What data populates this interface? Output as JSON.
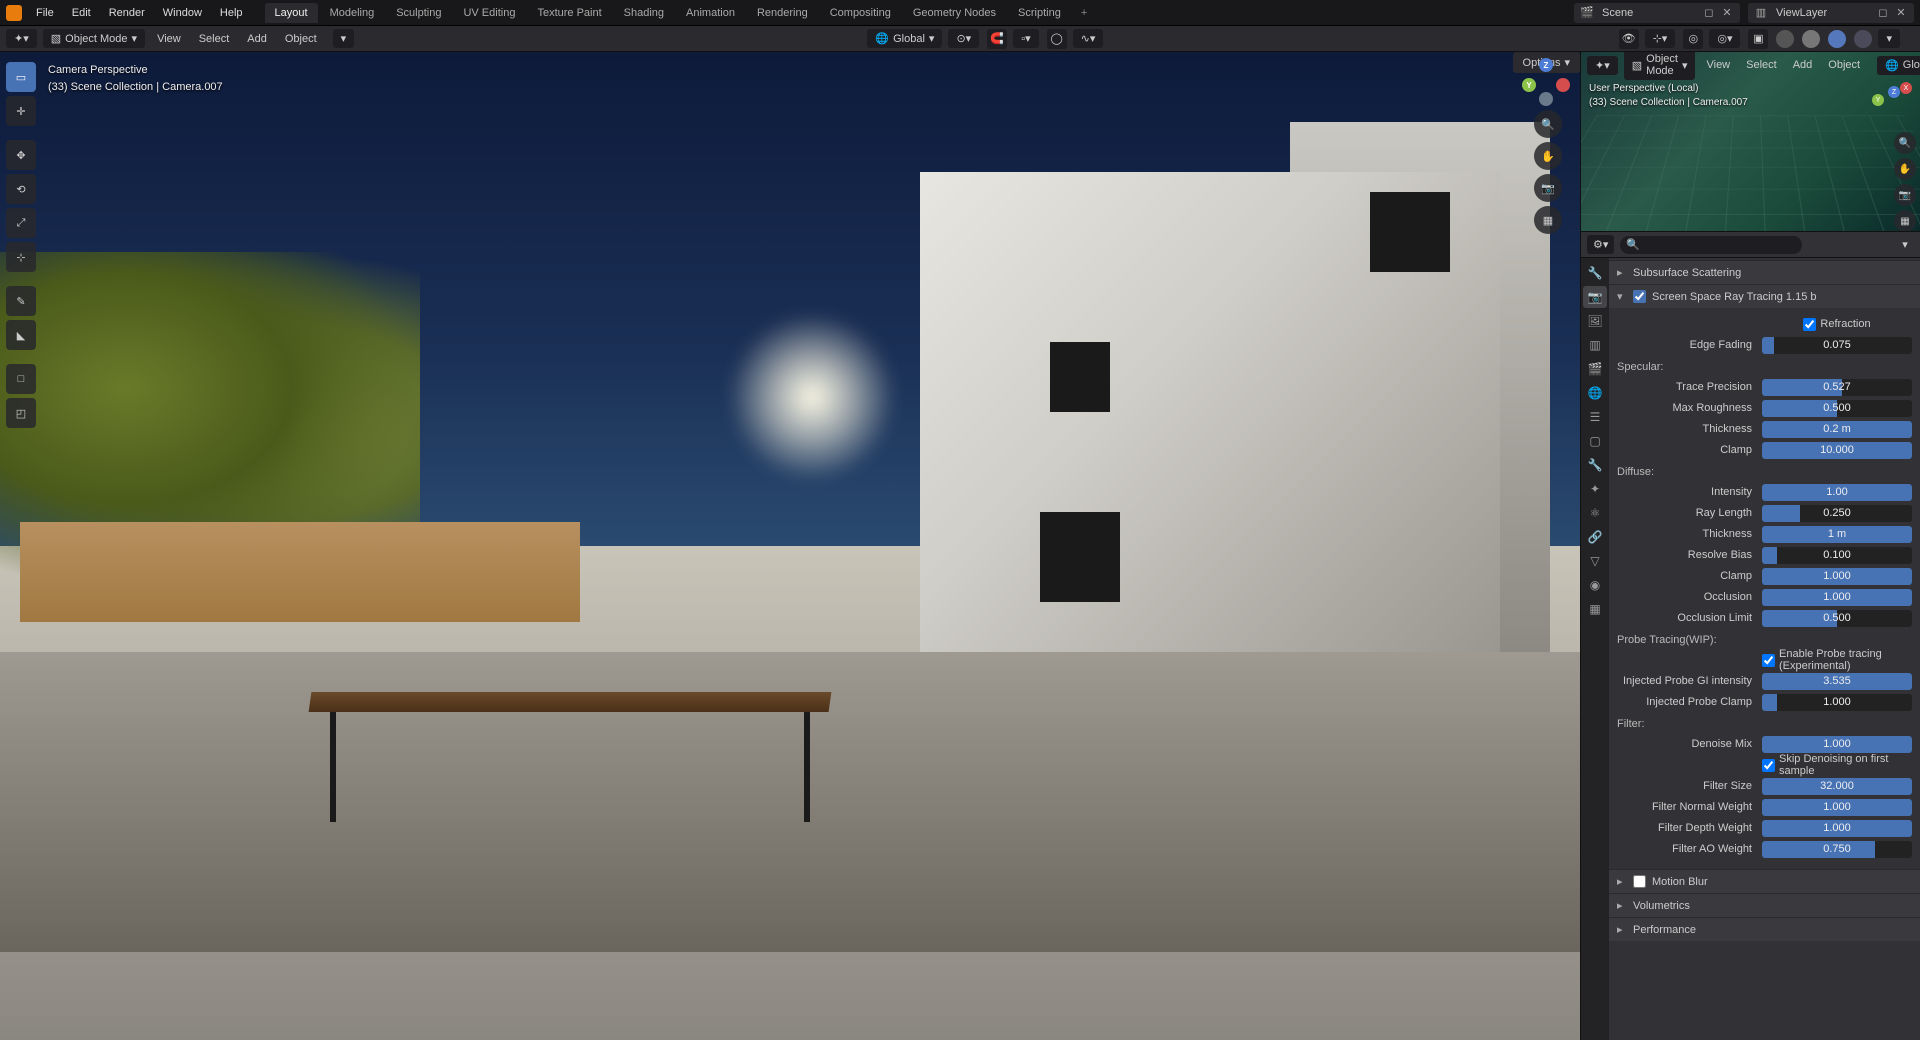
{
  "menus": [
    "File",
    "Edit",
    "Render",
    "Window",
    "Help"
  ],
  "tabs": [
    "Layout",
    "Modeling",
    "Sculpting",
    "UV Editing",
    "Texture Paint",
    "Shading",
    "Animation",
    "Rendering",
    "Compositing",
    "Geometry Nodes",
    "Scripting"
  ],
  "active_tab": 0,
  "scene_field": "Scene",
  "viewlayer_field": "ViewLayer",
  "header2": {
    "mode": "Object Mode",
    "view": "View",
    "select": "Select",
    "add": "Add",
    "object": "Object",
    "orient": "Global"
  },
  "header2b": {
    "mode": "Object Mode",
    "view": "View",
    "select": "Select",
    "add": "Add",
    "object": "Object",
    "global": "Global"
  },
  "viewport_overlay": {
    "line1": "Camera Perspective",
    "line2": "(33) Scene Collection | Camera.007"
  },
  "mini_overlay": {
    "line1": "User Perspective (Local)",
    "line2": "(33) Scene Collection | Camera.007"
  },
  "options_label": "Options",
  "panels": {
    "subsurface": "Subsurface Scattering",
    "ssrt": {
      "title": "Screen Space Ray Tracing 1.15 b",
      "checked": true
    },
    "refraction": {
      "label": "Refraction",
      "checked": true
    },
    "edge_fading": {
      "label": "Edge Fading",
      "value": "0.075",
      "pct": 8
    },
    "specular_header": "Specular:",
    "trace_precision": {
      "label": "Trace Precision",
      "value": "0.527",
      "pct": 53
    },
    "max_roughness": {
      "label": "Max Roughness",
      "value": "0.500",
      "pct": 50
    },
    "thickness": {
      "label": "Thickness",
      "value": "0.2 m",
      "pct": 100
    },
    "clamp": {
      "label": "Clamp",
      "value": "10.000",
      "pct": 100
    },
    "diffuse_header": "Diffuse:",
    "d_intensity": {
      "label": "Intensity",
      "value": "1.00",
      "pct": 100
    },
    "d_raylength": {
      "label": "Ray Length",
      "value": "0.250",
      "pct": 25
    },
    "d_thickness": {
      "label": "Thickness",
      "value": "1 m",
      "pct": 100
    },
    "d_resolvebias": {
      "label": "Resolve Bias",
      "value": "0.100",
      "pct": 10
    },
    "d_clamp": {
      "label": "Clamp",
      "value": "1.000",
      "pct": 100
    },
    "d_occlusion": {
      "label": "Occlusion",
      "value": "1.000",
      "pct": 100
    },
    "d_occlimit": {
      "label": "Occlusion Limit",
      "value": "0.500",
      "pct": 50
    },
    "probe_header": "Probe Tracing(WIP):",
    "probe_enable": {
      "label": "Enable Probe tracing (Experimental)",
      "checked": true
    },
    "probe_gi": {
      "label": "Injected Probe GI intensity",
      "value": "3.535",
      "pct": 100
    },
    "probe_clamp": {
      "label": "Injected Probe Clamp",
      "value": "1.000",
      "pct": 10
    },
    "filter_header": "Filter:",
    "denoise_mix": {
      "label": "Denoise Mix",
      "value": "1.000",
      "pct": 100
    },
    "skip_denoise": {
      "label": "Skip Denoising on first sample",
      "checked": true
    },
    "filter_size": {
      "label": "Filter Size",
      "value": "32.000",
      "pct": 100
    },
    "f_normal": {
      "label": "Filter Normal Weight",
      "value": "1.000",
      "pct": 100
    },
    "f_depth": {
      "label": "Filter Depth Weight",
      "value": "1.000",
      "pct": 100
    },
    "f_ao": {
      "label": "Filter AO Weight",
      "value": "0.750",
      "pct": 75
    },
    "motion_blur": "Motion Blur",
    "volumetrics": "Volumetrics",
    "performance": "Performance"
  },
  "icons": {
    "cursor": "⊹",
    "move": "✥",
    "rotate": "⟲",
    "scale": "⤢",
    "transform": "▭",
    "annotate": "✎",
    "measure": "📐",
    "addcube": "□",
    "shear": "◫"
  }
}
